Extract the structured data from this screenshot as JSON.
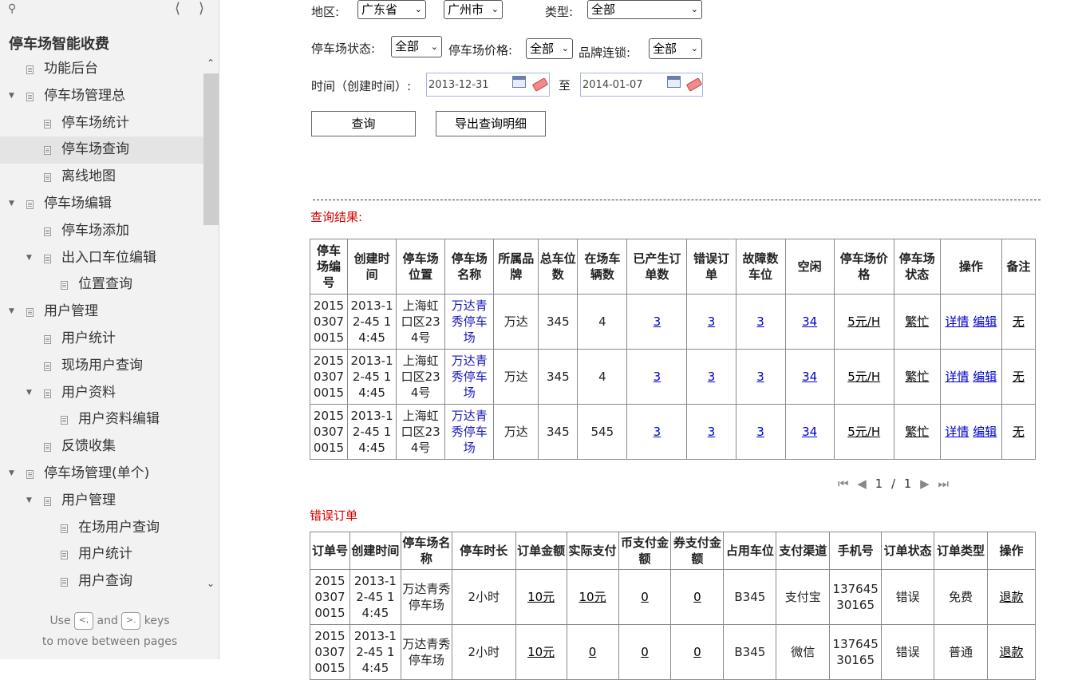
{
  "sidebar": {
    "title": "停车场智能收费",
    "tree": [
      {
        "label": "功能后台",
        "level": 1,
        "arrow": false,
        "selected": false
      },
      {
        "label": "停车场管理总",
        "level": 1,
        "arrow": true,
        "selected": false
      },
      {
        "label": "停车场统计",
        "level": 2,
        "arrow": false,
        "selected": false
      },
      {
        "label": "停车场查询",
        "level": 2,
        "arrow": false,
        "selected": true
      },
      {
        "label": "离线地图",
        "level": 2,
        "arrow": false,
        "selected": false
      },
      {
        "label": "停车场编辑",
        "level": 1,
        "arrow": true,
        "selected": false
      },
      {
        "label": "停车场添加",
        "level": 2,
        "arrow": false,
        "selected": false
      },
      {
        "label": "出入口车位编辑",
        "level": 2,
        "arrow": true,
        "selected": false
      },
      {
        "label": "位置查询",
        "level": 3,
        "arrow": false,
        "selected": false
      },
      {
        "label": "用户管理",
        "level": 1,
        "arrow": true,
        "selected": false
      },
      {
        "label": "用户统计",
        "level": 2,
        "arrow": false,
        "selected": false
      },
      {
        "label": "现场用户查询",
        "level": 2,
        "arrow": false,
        "selected": false
      },
      {
        "label": "用户资料",
        "level": 2,
        "arrow": true,
        "selected": false
      },
      {
        "label": "用户资料编辑",
        "level": 3,
        "arrow": false,
        "selected": false
      },
      {
        "label": "反馈收集",
        "level": 2,
        "arrow": false,
        "selected": false
      },
      {
        "label": "停车场管理(单个)",
        "level": 1,
        "arrow": true,
        "selected": false
      },
      {
        "label": "用户管理",
        "level": 2,
        "arrow": true,
        "selected": false
      },
      {
        "label": "在场用户查询",
        "level": 3,
        "arrow": false,
        "selected": false
      },
      {
        "label": "用户统计",
        "level": 3,
        "arrow": false,
        "selected": false
      },
      {
        "label": "用户查询",
        "level": 3,
        "arrow": false,
        "selected": false
      }
    ],
    "hint_use": "Use",
    "hint_and": "and",
    "hint_keys": "keys",
    "hint_line2": "to move between pages",
    "key_prev": "<,",
    "key_next": ">."
  },
  "filters": {
    "region_label": "地区:",
    "province": "广东省",
    "city": "广州市",
    "type_label": "类型:",
    "type_value": "全部",
    "status_label": "停车场状态:",
    "status_value": "全部",
    "price_label": "停车场价格:",
    "price_value": "全部",
    "brand_label": "品牌连锁:",
    "brand_value": "全部",
    "time_label": "时间（创建时间）:",
    "date_from": "2013-12-31",
    "to_label": "至",
    "date_to": "2014-01-07",
    "query_button": "查询",
    "export_button": "导出查询明细"
  },
  "results": {
    "title": "查询结果:",
    "headers": [
      "停车场编号",
      "创建时间",
      "停车场位置",
      "停车场名称",
      "所属品牌",
      "总车位数",
      "在场车辆数",
      "已产生订单数",
      "错误订单",
      "故障数车位",
      "空闲",
      "停车场价格",
      "停车场状态",
      "操作",
      "备注"
    ],
    "rows": [
      {
        "id": "201503070015",
        "created": "2013-12-45 14:45",
        "location": "上海虹口区234号",
        "name": "万达青秀停车场",
        "brand": "万达",
        "total": "345",
        "present": "4",
        "orders": "3",
        "errors": "3",
        "faults": "3",
        "free": "34",
        "price": "5元/H",
        "status": "繁忙",
        "op_detail": "详情",
        "op_edit": "编辑",
        "note": "无"
      },
      {
        "id": "201503070015",
        "created": "2013-12-45 14:45",
        "location": "上海虹口区234号",
        "name": "万达青秀停车场",
        "brand": "万达",
        "total": "345",
        "present": "4",
        "orders": "3",
        "errors": "3",
        "faults": "3",
        "free": "34",
        "price": "5元/H",
        "status": "繁忙",
        "op_detail": "详情",
        "op_edit": "编辑",
        "note": "无"
      },
      {
        "id": "201503070015",
        "created": "2013-12-45 14:45",
        "location": "上海虹口区234号",
        "name": "万达青秀停车场",
        "brand": "万达",
        "total": "345",
        "present": "545",
        "orders": "3",
        "errors": "3",
        "faults": "3",
        "free": "34",
        "price": "5元/H",
        "status": "繁忙",
        "op_detail": "详情",
        "op_edit": "编辑",
        "note": "无"
      }
    ]
  },
  "pager": {
    "current": "1",
    "sep": "/",
    "total": "1"
  },
  "errors": {
    "title": "错误订单",
    "headers": [
      "订单号",
      "创建时间",
      "停车场名称",
      "停车时长",
      "订单金额",
      "实际支付",
      "币支付金额",
      "券支付金额",
      "占用车位",
      "支付渠道",
      "手机号",
      "订单状态",
      "订单类型",
      "操作"
    ],
    "rows": [
      {
        "order": "201503070015",
        "created": "2013-12-45 14:45",
        "name": "万达青秀停车场",
        "duration": "2小时",
        "amount": "10元",
        "paid": "10元",
        "coin": "0",
        "coupon": "0",
        "spot": "B345",
        "channel": "支付宝",
        "phone": "13764530165",
        "status": "错误",
        "type": "免费",
        "op": "退款"
      },
      {
        "order": "201503070015",
        "created": "2013-12-45 14:45",
        "name": "万达青秀停车场",
        "duration": "2小时",
        "amount": "10元",
        "paid": "0",
        "coin": "0",
        "coupon": "0",
        "spot": "B345",
        "channel": "微信",
        "phone": "13764530165",
        "status": "错误",
        "type": "普通",
        "op": "退款"
      }
    ]
  }
}
